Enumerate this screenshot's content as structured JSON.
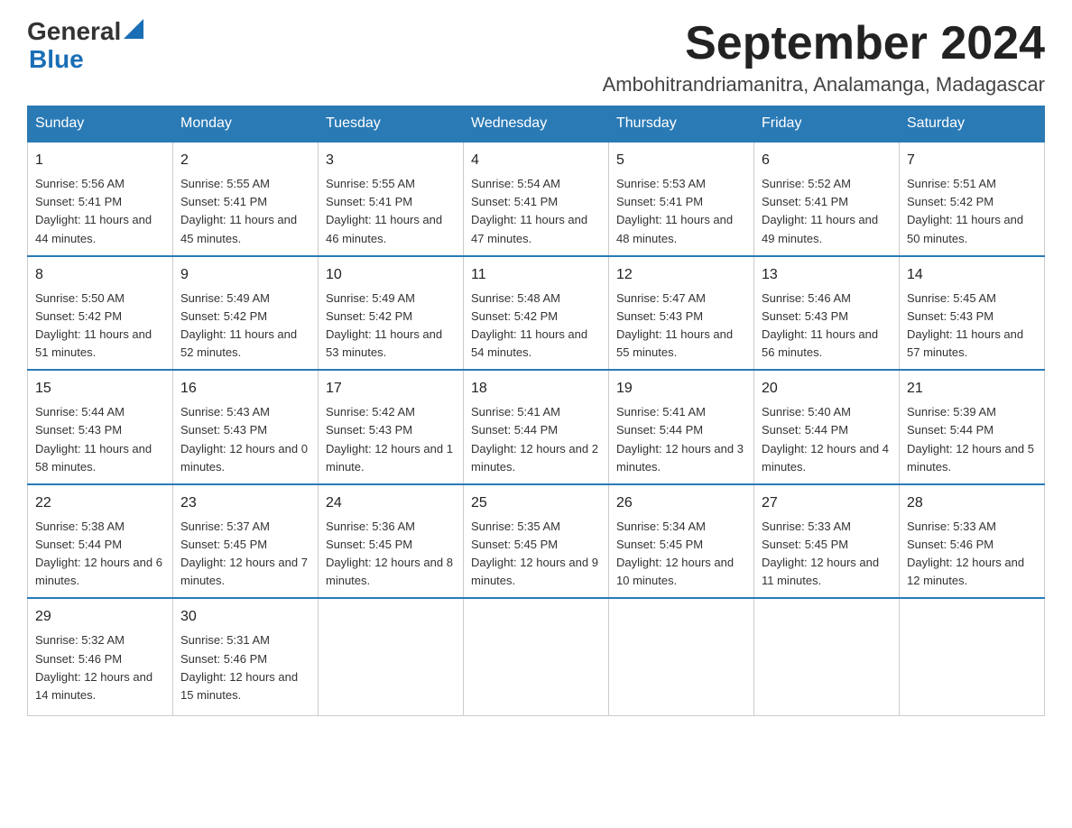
{
  "header": {
    "logo_general": "General",
    "logo_blue": "Blue",
    "month_title": "September 2024",
    "location": "Ambohitrandriamanitra, Analamanga, Madagascar"
  },
  "weekdays": [
    "Sunday",
    "Monday",
    "Tuesday",
    "Wednesday",
    "Thursday",
    "Friday",
    "Saturday"
  ],
  "weeks": [
    [
      {
        "day": "1",
        "sunrise": "5:56 AM",
        "sunset": "5:41 PM",
        "daylight": "11 hours and 44 minutes."
      },
      {
        "day": "2",
        "sunrise": "5:55 AM",
        "sunset": "5:41 PM",
        "daylight": "11 hours and 45 minutes."
      },
      {
        "day": "3",
        "sunrise": "5:55 AM",
        "sunset": "5:41 PM",
        "daylight": "11 hours and 46 minutes."
      },
      {
        "day": "4",
        "sunrise": "5:54 AM",
        "sunset": "5:41 PM",
        "daylight": "11 hours and 47 minutes."
      },
      {
        "day": "5",
        "sunrise": "5:53 AM",
        "sunset": "5:41 PM",
        "daylight": "11 hours and 48 minutes."
      },
      {
        "day": "6",
        "sunrise": "5:52 AM",
        "sunset": "5:41 PM",
        "daylight": "11 hours and 49 minutes."
      },
      {
        "day": "7",
        "sunrise": "5:51 AM",
        "sunset": "5:42 PM",
        "daylight": "11 hours and 50 minutes."
      }
    ],
    [
      {
        "day": "8",
        "sunrise": "5:50 AM",
        "sunset": "5:42 PM",
        "daylight": "11 hours and 51 minutes."
      },
      {
        "day": "9",
        "sunrise": "5:49 AM",
        "sunset": "5:42 PM",
        "daylight": "11 hours and 52 minutes."
      },
      {
        "day": "10",
        "sunrise": "5:49 AM",
        "sunset": "5:42 PM",
        "daylight": "11 hours and 53 minutes."
      },
      {
        "day": "11",
        "sunrise": "5:48 AM",
        "sunset": "5:42 PM",
        "daylight": "11 hours and 54 minutes."
      },
      {
        "day": "12",
        "sunrise": "5:47 AM",
        "sunset": "5:43 PM",
        "daylight": "11 hours and 55 minutes."
      },
      {
        "day": "13",
        "sunrise": "5:46 AM",
        "sunset": "5:43 PM",
        "daylight": "11 hours and 56 minutes."
      },
      {
        "day": "14",
        "sunrise": "5:45 AM",
        "sunset": "5:43 PM",
        "daylight": "11 hours and 57 minutes."
      }
    ],
    [
      {
        "day": "15",
        "sunrise": "5:44 AM",
        "sunset": "5:43 PM",
        "daylight": "11 hours and 58 minutes."
      },
      {
        "day": "16",
        "sunrise": "5:43 AM",
        "sunset": "5:43 PM",
        "daylight": "12 hours and 0 minutes."
      },
      {
        "day": "17",
        "sunrise": "5:42 AM",
        "sunset": "5:43 PM",
        "daylight": "12 hours and 1 minute."
      },
      {
        "day": "18",
        "sunrise": "5:41 AM",
        "sunset": "5:44 PM",
        "daylight": "12 hours and 2 minutes."
      },
      {
        "day": "19",
        "sunrise": "5:41 AM",
        "sunset": "5:44 PM",
        "daylight": "12 hours and 3 minutes."
      },
      {
        "day": "20",
        "sunrise": "5:40 AM",
        "sunset": "5:44 PM",
        "daylight": "12 hours and 4 minutes."
      },
      {
        "day": "21",
        "sunrise": "5:39 AM",
        "sunset": "5:44 PM",
        "daylight": "12 hours and 5 minutes."
      }
    ],
    [
      {
        "day": "22",
        "sunrise": "5:38 AM",
        "sunset": "5:44 PM",
        "daylight": "12 hours and 6 minutes."
      },
      {
        "day": "23",
        "sunrise": "5:37 AM",
        "sunset": "5:45 PM",
        "daylight": "12 hours and 7 minutes."
      },
      {
        "day": "24",
        "sunrise": "5:36 AM",
        "sunset": "5:45 PM",
        "daylight": "12 hours and 8 minutes."
      },
      {
        "day": "25",
        "sunrise": "5:35 AM",
        "sunset": "5:45 PM",
        "daylight": "12 hours and 9 minutes."
      },
      {
        "day": "26",
        "sunrise": "5:34 AM",
        "sunset": "5:45 PM",
        "daylight": "12 hours and 10 minutes."
      },
      {
        "day": "27",
        "sunrise": "5:33 AM",
        "sunset": "5:45 PM",
        "daylight": "12 hours and 11 minutes."
      },
      {
        "day": "28",
        "sunrise": "5:33 AM",
        "sunset": "5:46 PM",
        "daylight": "12 hours and 12 minutes."
      }
    ],
    [
      {
        "day": "29",
        "sunrise": "5:32 AM",
        "sunset": "5:46 PM",
        "daylight": "12 hours and 14 minutes."
      },
      {
        "day": "30",
        "sunrise": "5:31 AM",
        "sunset": "5:46 PM",
        "daylight": "12 hours and 15 minutes."
      },
      null,
      null,
      null,
      null,
      null
    ]
  ]
}
